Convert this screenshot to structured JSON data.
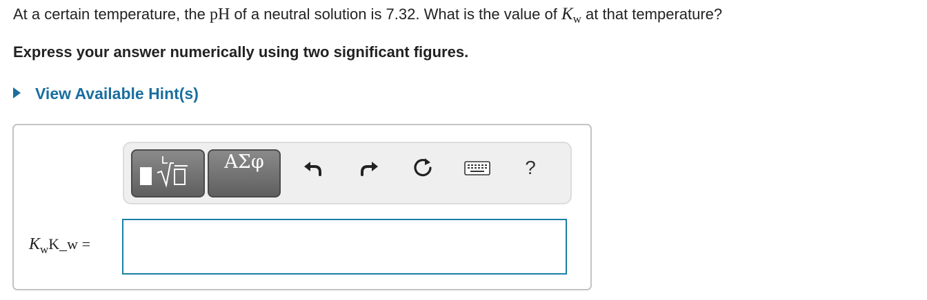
{
  "question": {
    "prefix": "At a certain temperature, the",
    "ph": "pH",
    "middle": "of a neutral solution is 7.32. What is the value of",
    "kw_main": "K",
    "kw_sub": "w",
    "suffix": "at that temperature?"
  },
  "instruction": "Express your answer numerically using two significant figures.",
  "hint": {
    "label": "View Available Hint(s)"
  },
  "toolbar": {
    "templates_icon": "templates-sqrt-icon",
    "symbols_label": "ΑΣφ",
    "undo_icon": "undo-icon",
    "redo_icon": "redo-icon",
    "reset_icon": "reset-icon",
    "keyboard_icon": "keyboard-icon",
    "help_label": "?"
  },
  "answer": {
    "label_k": "K",
    "label_sub": "w",
    "label_raw": "K_w =",
    "value": ""
  },
  "colors": {
    "link": "#1a6e9e",
    "input_border": "#1a7ea6",
    "button_dark": "#5f5f5f"
  }
}
